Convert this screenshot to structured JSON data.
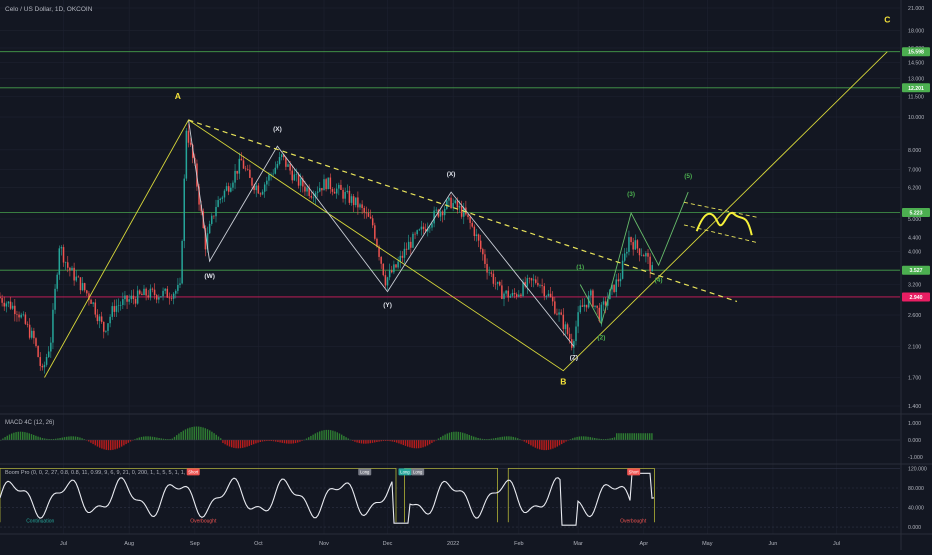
{
  "header": {
    "title": "Celo / US Dollar, 1D, OKCOIN"
  },
  "colors": {
    "background": "#131722",
    "grid": "#1e2230",
    "bull": "#26a69a",
    "bear": "#ef5350",
    "wave": "#d6d63a",
    "trend": "#e8e35a",
    "level": "#4caf50",
    "support": "#e91e63",
    "white": "#d1d4dc",
    "green_label": "#4caf50"
  },
  "price_axis": {
    "currency": "USD",
    "ticks": [
      "21.000",
      "18.000",
      "16.000",
      "14.500",
      "13.000",
      "11.500",
      "10.000",
      "8.000",
      "7.000",
      "6.200",
      "5.000",
      "4.400",
      "4.000",
      "3.200",
      "2.600",
      "2.100",
      "1.700",
      "1.400"
    ],
    "badges": [
      {
        "text": "15.598",
        "kind": "level"
      },
      {
        "text": "12.201",
        "kind": "level"
      },
      {
        "text": "5.223",
        "kind": "level"
      },
      {
        "text": "3.527",
        "kind": "level"
      },
      {
        "text": "2.940",
        "kind": "support"
      }
    ]
  },
  "time_axis": {
    "ticks": [
      "Jul",
      "Aug",
      "Sep",
      "Oct",
      "Nov",
      "Dec",
      "2022",
      "Feb",
      "Mar",
      "Apr",
      "May",
      "Jun",
      "Jul"
    ]
  },
  "wave_labels": [
    {
      "text": "A",
      "color": "yellow"
    },
    {
      "text": "B",
      "color": "yellow"
    },
    {
      "text": "C",
      "color": "yellow"
    },
    {
      "text": "(X)",
      "color": "white"
    },
    {
      "text": "(X)",
      "color": "white"
    },
    {
      "text": "(W)",
      "color": "white"
    },
    {
      "text": "(Y)",
      "color": "white"
    },
    {
      "text": "(Z)",
      "color": "white"
    },
    {
      "text": "(1)",
      "color": "green"
    },
    {
      "text": "(2)",
      "color": "green"
    },
    {
      "text": "(3)",
      "color": "green"
    },
    {
      "text": "(4)",
      "color": "green"
    },
    {
      "text": "(5)",
      "color": "green"
    }
  ],
  "macd": {
    "title": "MACD 4C (12, 26)",
    "ticks": [
      "1.000",
      "0.000",
      "-1.000"
    ]
  },
  "boom": {
    "title": "Boom Pro (0, 0, 2, 27, 0.8, 0.8, 11, 0.99, 9, 6, 9, 21, 0, 200, 1, 1, 5, 5, 1, 1, 1)",
    "ticks": [
      "120.000",
      "80.000",
      "40.000",
      "0.000"
    ],
    "markers": [
      "Short",
      "Long",
      "Long",
      "Long",
      "Short"
    ],
    "annotations": [
      "Continuation",
      "Overbought",
      "Overbought"
    ]
  },
  "chart_data": {
    "type": "candlestick",
    "title": "Celo / US Dollar, 1D, OKCOIN",
    "xlabel": "",
    "ylabel": "",
    "log_scale": true,
    "x_range": [
      "2021-06-01",
      "2022-07-31"
    ],
    "y_range": [
      1.4,
      21.0
    ],
    "grid": true,
    "horizontal_levels": [
      15.598,
      12.201,
      5.223,
      3.527,
      2.94
    ],
    "wave_path_primary": [
      {
        "label": "start",
        "date": "2021-06-22",
        "price": 1.7
      },
      {
        "label": "A",
        "date": "2021-08-29",
        "price": 9.8
      },
      {
        "label": "B",
        "date": "2022-02-22",
        "price": 1.78
      },
      {
        "label": "C",
        "date": "2022-07-25",
        "price": 15.598
      }
    ],
    "wave_path_wxyxz": [
      {
        "label": "",
        "date": "2021-08-29",
        "price": 9.8
      },
      {
        "label": "(W)",
        "date": "2021-09-08",
        "price": 3.75
      },
      {
        "label": "(X)",
        "date": "2021-10-10",
        "price": 8.2
      },
      {
        "label": "(Y)",
        "date": "2021-12-01",
        "price": 3.05
      },
      {
        "label": "(X)",
        "date": "2021-12-31",
        "price": 6.0
      },
      {
        "label": "(Z)",
        "date": "2022-02-27",
        "price": 2.1
      }
    ],
    "wave_path_impulse": [
      {
        "label": "(1)",
        "date": "2022-03-02",
        "price": 3.2
      },
      {
        "label": "(2)",
        "date": "2022-03-12",
        "price": 2.45
      },
      {
        "label": "(3)",
        "date": "2022-03-26",
        "price": 5.2
      },
      {
        "label": "(4)",
        "date": "2022-04-08",
        "price": 3.65
      },
      {
        "label": "(5)",
        "date": "2022-04-22",
        "price": 6.0
      }
    ],
    "trendline_dashed": [
      {
        "date": "2021-08-29",
        "price": 9.8
      },
      {
        "date": "2022-05-15",
        "price": 2.85
      }
    ],
    "projection_channel": {
      "upper": [
        {
          "date": "2022-04-20",
          "price": 5.6
        },
        {
          "date": "2022-05-25",
          "price": 5.05
        }
      ],
      "lower": [
        {
          "date": "2022-04-20",
          "price": 4.8
        },
        {
          "date": "2022-05-25",
          "price": 4.25
        }
      ]
    },
    "price_path": [
      [
        "2021-06-01",
        2.95
      ],
      [
        "2021-06-10",
        2.7
      ],
      [
        "2021-06-18",
        2.2
      ],
      [
        "2021-06-22",
        1.75
      ],
      [
        "2021-06-26",
        2.2
      ],
      [
        "2021-06-30",
        4.2
      ],
      [
        "2021-07-04",
        3.6
      ],
      [
        "2021-07-10",
        3.2
      ],
      [
        "2021-07-15",
        2.9
      ],
      [
        "2021-07-21",
        2.35
      ],
      [
        "2021-07-26",
        2.75
      ],
      [
        "2021-08-03",
        2.9
      ],
      [
        "2021-08-10",
        3.0
      ],
      [
        "2021-08-20",
        3.0
      ],
      [
        "2021-08-26",
        3.1
      ],
      [
        "2021-08-29",
        9.3
      ],
      [
        "2021-09-02",
        7.0
      ],
      [
        "2021-09-07",
        4.2
      ],
      [
        "2021-09-12",
        5.5
      ],
      [
        "2021-09-18",
        6.3
      ],
      [
        "2021-09-24",
        7.4
      ],
      [
        "2021-09-28",
        6.5
      ],
      [
        "2021-10-03",
        6.1
      ],
      [
        "2021-10-08",
        6.8
      ],
      [
        "2021-10-13",
        7.6
      ],
      [
        "2021-10-20",
        6.5
      ],
      [
        "2021-10-27",
        6.0
      ],
      [
        "2021-11-03",
        6.4
      ],
      [
        "2021-11-10",
        6.0
      ],
      [
        "2021-11-18",
        5.5
      ],
      [
        "2021-11-25",
        4.8
      ],
      [
        "2021-12-01",
        3.3
      ],
      [
        "2021-12-06",
        3.6
      ],
      [
        "2021-12-12",
        4.2
      ],
      [
        "2021-12-18",
        4.6
      ],
      [
        "2021-12-25",
        5.2
      ],
      [
        "2022-01-01",
        5.6
      ],
      [
        "2022-01-07",
        5.2
      ],
      [
        "2022-01-12",
        4.6
      ],
      [
        "2022-01-18",
        3.6
      ],
      [
        "2022-01-24",
        3.05
      ],
      [
        "2022-01-30",
        2.95
      ],
      [
        "2022-02-06",
        3.2
      ],
      [
        "2022-02-11",
        3.3
      ],
      [
        "2022-02-17",
        2.9
      ],
      [
        "2022-02-23",
        2.45
      ],
      [
        "2022-02-27",
        2.15
      ],
      [
        "2022-03-03",
        2.7
      ],
      [
        "2022-03-08",
        2.95
      ],
      [
        "2022-03-12",
        2.6
      ],
      [
        "2022-03-17",
        3.0
      ],
      [
        "2022-03-22",
        3.4
      ],
      [
        "2022-03-26",
        4.4
      ],
      [
        "2022-03-30",
        4.1
      ],
      [
        "2022-04-03",
        3.9
      ],
      [
        "2022-04-06",
        3.5
      ]
    ],
    "macd": {
      "ylim": [
        -1.3,
        1.3
      ],
      "histogram_range": "oscillates around 0.000"
    },
    "boom_pro": {
      "ylim": [
        -10,
        125
      ],
      "levels": [
        0,
        40,
        80,
        120
      ]
    }
  }
}
